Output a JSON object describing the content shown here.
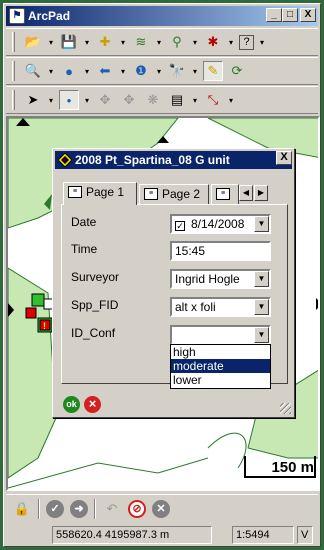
{
  "app": {
    "title": "ArcPad"
  },
  "window_buttons": {
    "minimize": "_",
    "maximize": "□",
    "close": "X"
  },
  "toolbars": {
    "row1": [
      "open-icon",
      "save-icon",
      "add-layer-icon",
      "layer-manager-icon",
      "gps-icon",
      "tools-icon",
      "help-icon"
    ],
    "row2": [
      "zoom-in-icon",
      "full-extent-icon",
      "back-icon",
      "identify-icon",
      "find-icon",
      "edit-icon",
      "refresh-icon"
    ],
    "row3": [
      "pointer-icon",
      "point-icon",
      "pan-icon",
      "measure-icon",
      "select-icon",
      "form-icon",
      "line-icon"
    ]
  },
  "map": {
    "scale_label": "150 m"
  },
  "dialog": {
    "title": "2008 Pt_Spartina_08 G unit",
    "close": "X",
    "tabs": [
      "Page 1",
      "Page 2"
    ],
    "active_tab": "Page 1",
    "fields": [
      {
        "label": "Date",
        "value": "8/14/2008",
        "type": "date",
        "checked": true
      },
      {
        "label": "Time",
        "value": "15:45",
        "type": "text"
      },
      {
        "label": "Surveyor",
        "value": "Ingrid Hogle",
        "type": "combo"
      },
      {
        "label": "Spp_FID",
        "value": "alt x foli",
        "type": "combo"
      },
      {
        "label": "ID_Conf",
        "value": "",
        "type": "combo"
      }
    ],
    "dropdown_options": [
      "high",
      "moderate",
      "lower"
    ],
    "dropdown_selected": "moderate",
    "ok_label": "ok",
    "cancel_label": "×"
  },
  "bottom_toolbar": [
    "lock-icon",
    "gps-status-icon",
    "gps-next-icon",
    "undo-icon",
    "no-gps-icon",
    "clear-icon"
  ],
  "statusbar": {
    "coordinates": "558620.4 4195987.3 m",
    "scale": "1:5494",
    "mode": "V"
  },
  "colors": {
    "title_active": "#0a246a",
    "map_green": "#c7e8b3",
    "ok_green": "#1e8a1e",
    "cancel_red": "#d42020"
  }
}
